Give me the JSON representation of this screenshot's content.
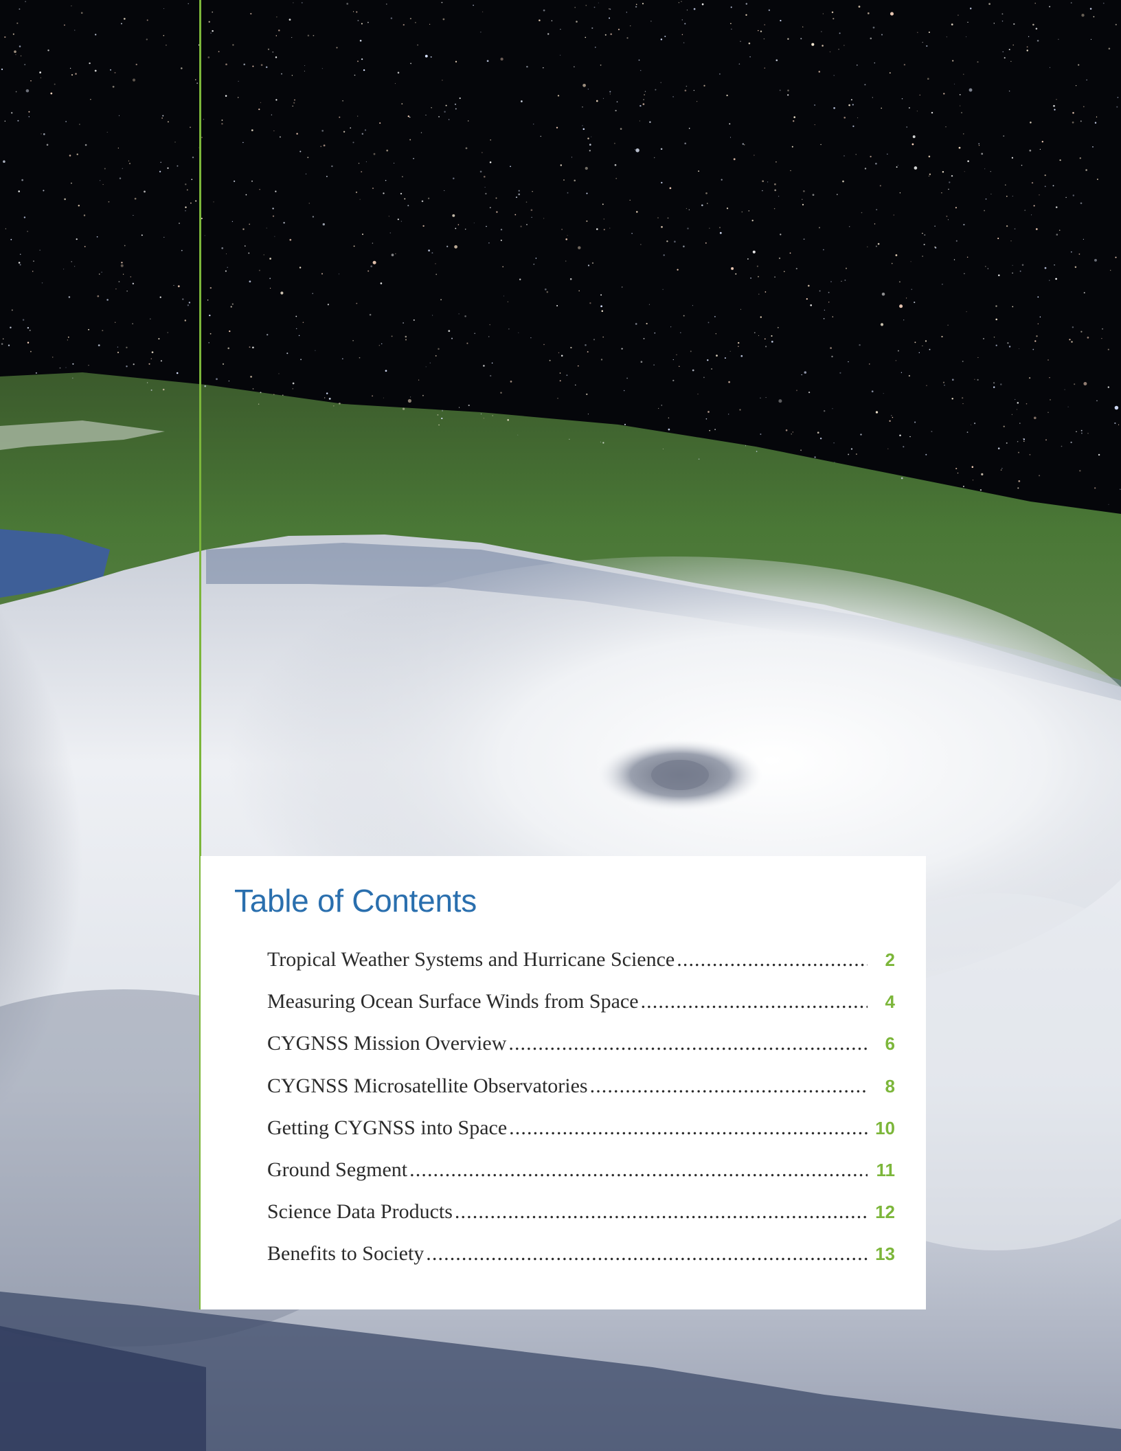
{
  "toc": {
    "title": "Table of Contents",
    "items": [
      {
        "label": "Tropical Weather Systems and Hurricane Science",
        "page": "2"
      },
      {
        "label": "Measuring Ocean Surface Winds from Space",
        "page": "4"
      },
      {
        "label": "CYGNSS Mission Overview",
        "page": "6"
      },
      {
        "label": "CYGNSS Microsatellite Observatories",
        "page": "8"
      },
      {
        "label": "Getting CYGNSS into Space",
        "page": "10"
      },
      {
        "label": "Ground Segment",
        "page": "11"
      },
      {
        "label": "Science Data Products",
        "page": "12"
      },
      {
        "label": "Benefits to Society",
        "page": "13"
      }
    ]
  },
  "colors": {
    "accent_green": "#7cb63a",
    "title_blue": "#2a6fae",
    "space_black": "#05060a"
  }
}
